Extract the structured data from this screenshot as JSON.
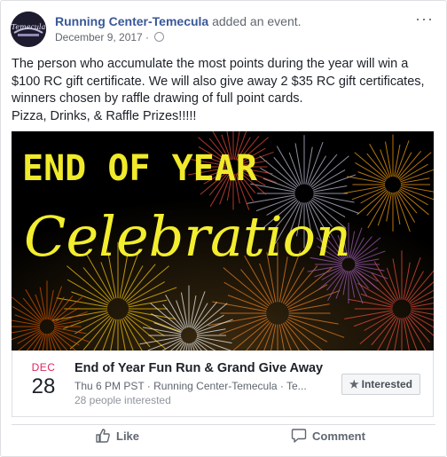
{
  "post": {
    "author": "Running Center-Temecula",
    "action_text": "added an event.",
    "date": "December 9, 2017 · ",
    "more_label": "···",
    "avatar_label": "Temecula",
    "body_lines": [
      "The person who accumulate the most points during the year will win a",
      "$100 RC gift certificate. We will also give away 2 $35 RC gift certificates,",
      "winners chosen by raffle drawing of full point cards.",
      "Pizza, Drinks, & Raffle Prizes!!!!!"
    ]
  },
  "cover": {
    "line1": "END OF YEAR",
    "line2": "Celebration",
    "accent_color": "#e6e13a"
  },
  "event": {
    "month": "DEC",
    "day": "28",
    "title": "End of Year Fun Run & Grand Give Away",
    "subtitle": "Thu 6 PM PST · Running Center-Temecula · Te...",
    "interested_count": "28 people interested",
    "interested_label": "Interested",
    "star_icon": "★"
  },
  "actions": {
    "like_label": "Like",
    "comment_label": "Comment"
  },
  "colors": {
    "link": "#385898",
    "month": "#e0245e"
  }
}
